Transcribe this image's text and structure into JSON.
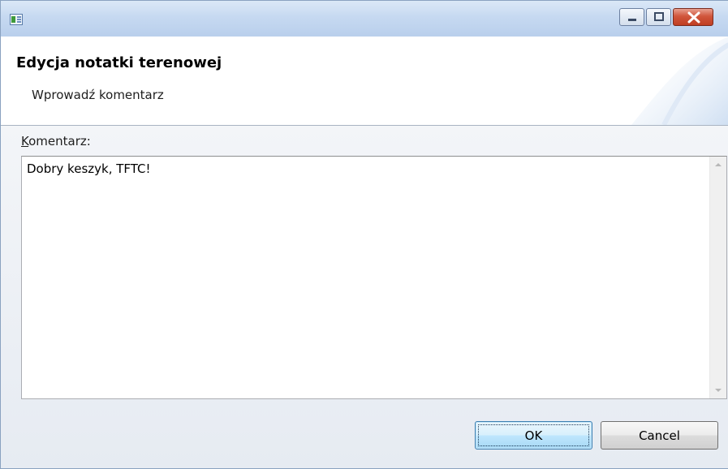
{
  "window": {
    "title": "",
    "icon": "app-form-icon",
    "controls": [
      "minimize-icon",
      "maximize-icon",
      "close-icon"
    ]
  },
  "header": {
    "title": "Edycja notatki terenowej",
    "subtitle": "Wprowadź komentarz"
  },
  "form": {
    "comment_label_mnemonic": "K",
    "comment_label_rest": "omentarz:",
    "comment_value": "Dobry keszyk, TFTC!"
  },
  "buttons": {
    "ok_label": "OK",
    "cancel_label": "Cancel"
  },
  "colors": {
    "titlebar": "#c6d9f1",
    "close_button": "#c9462b",
    "ok_button": "#bee6fd"
  }
}
